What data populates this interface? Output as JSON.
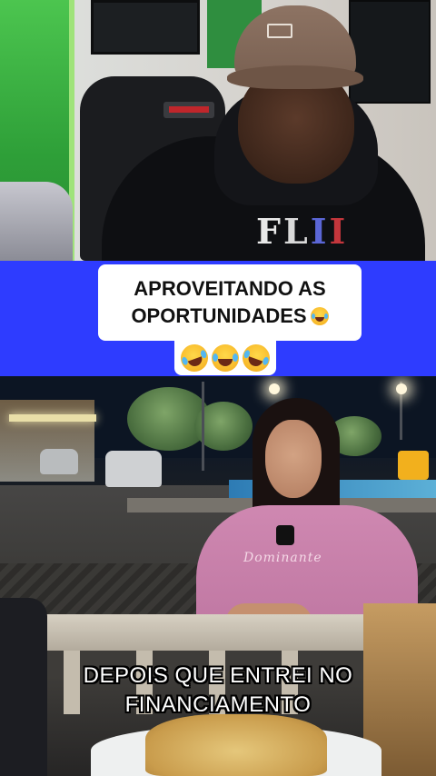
{
  "reactor": {
    "hoodie_print": [
      "F",
      "L",
      "I",
      "I"
    ]
  },
  "banner": {
    "caption_line1": "APROVEITANDO AS",
    "caption_line2": "OPORTUNIDADES",
    "emojis": [
      "rolling-on-floor-laughing",
      "face-with-tears-of-joy",
      "rolling-on-floor-laughing"
    ],
    "background_color": "#2e3cff"
  },
  "clip": {
    "shirt_text": "Dominante",
    "subtitle_line1": "DEPOIS QUE ENTREI NO",
    "subtitle_line2": "FINANCIAMENTO"
  }
}
